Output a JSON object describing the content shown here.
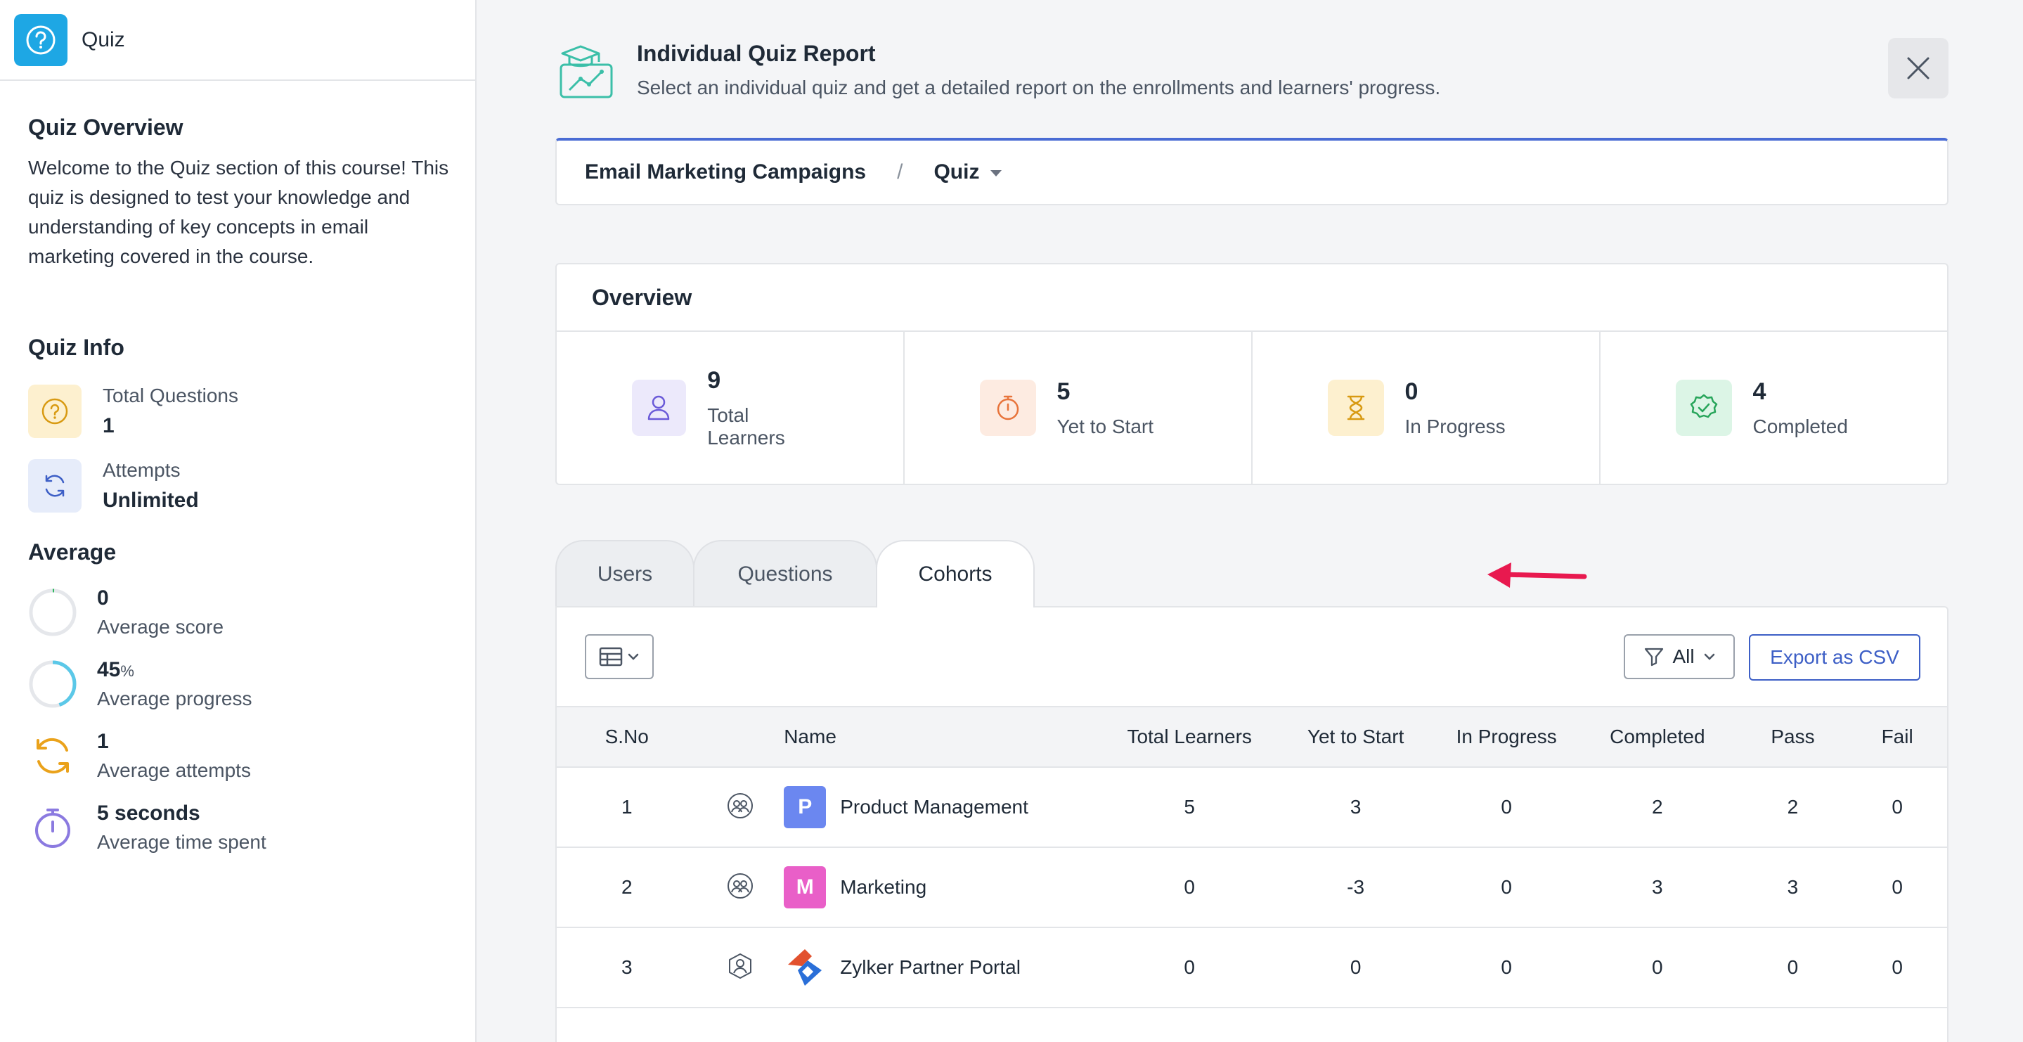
{
  "sidebar": {
    "app_title": "Quiz",
    "overview_title": "Quiz Overview",
    "overview_desc": "Welcome to the Quiz section of this course! This quiz is designed to test your knowledge and understanding of key concepts in email marketing covered in the course.",
    "info_title": "Quiz Info",
    "info": [
      {
        "label": "Total Questions",
        "value": "1",
        "icon": "question-icon"
      },
      {
        "label": "Attempts",
        "value": "Unlimited",
        "icon": "refresh-icon"
      }
    ],
    "average_title": "Average",
    "averages": [
      {
        "value": "0",
        "unit": "",
        "label": "Average score",
        "icon": "score-ring-icon",
        "progress": 0
      },
      {
        "value": "45",
        "unit": "%",
        "label": "Average progress",
        "icon": "progress-ring-icon",
        "progress": 45
      },
      {
        "value": "1",
        "unit": "",
        "label": "Average attempts",
        "icon": "attempts-icon"
      },
      {
        "value": "5 seconds",
        "unit": "",
        "label": "Average time spent",
        "icon": "stopwatch-icon"
      }
    ]
  },
  "header": {
    "title": "Individual Quiz Report",
    "subtitle": "Select an individual quiz and get a detailed report on the enrollments and learners' progress."
  },
  "breadcrumb": {
    "course": "Email Marketing Campaigns",
    "separator": "/",
    "current": "Quiz"
  },
  "overview": {
    "title": "Overview",
    "stats": [
      {
        "value": "9",
        "label": "Total Learners",
        "icon": "user-icon",
        "color": "#6a5ad8",
        "bg": "#ece9fb"
      },
      {
        "value": "5",
        "label": "Yet to Start",
        "icon": "timer-icon",
        "color": "#e8743b",
        "bg": "#fdebe1"
      },
      {
        "value": "0",
        "label": "In Progress",
        "icon": "hourglass-icon",
        "color": "#d89a12",
        "bg": "#fdf0cf"
      },
      {
        "value": "4",
        "label": "Completed",
        "icon": "badge-check-icon",
        "color": "#27a55a",
        "bg": "#dcf5e6"
      }
    ]
  },
  "tabs": [
    "Users",
    "Questions",
    "Cohorts"
  ],
  "active_tab": "Cohorts",
  "toolbar": {
    "filter_label": "All",
    "export_label": "Export as CSV"
  },
  "table": {
    "columns": [
      "S.No",
      "",
      "Name",
      "Total Learners",
      "Yet to Start",
      "In Progress",
      "Completed",
      "Pass",
      "Fail"
    ],
    "rows": [
      {
        "sno": "1",
        "icon": "group-icon",
        "avatar": "P",
        "avatar_color": "#6b87f0",
        "name": "Product Management",
        "total": "5",
        "yts": "3",
        "ip": "0",
        "comp": "2",
        "pass": "2",
        "fail": "0"
      },
      {
        "sno": "2",
        "icon": "group-icon",
        "avatar": "M",
        "avatar_color": "#e95fc8",
        "name": "Marketing",
        "total": "0",
        "yts": "-3",
        "ip": "0",
        "comp": "3",
        "pass": "3",
        "fail": "0"
      },
      {
        "sno": "3",
        "icon": "hexagon-user-icon",
        "avatar": "",
        "avatar_color": "",
        "name": "Zylker Partner Portal",
        "total": "0",
        "yts": "0",
        "ip": "0",
        "comp": "0",
        "pass": "0",
        "fail": "0"
      }
    ]
  },
  "colors": {
    "accent": "#3d5fc6",
    "app_icon": "#1ea7e4",
    "annotation_arrow": "#e8194f"
  }
}
